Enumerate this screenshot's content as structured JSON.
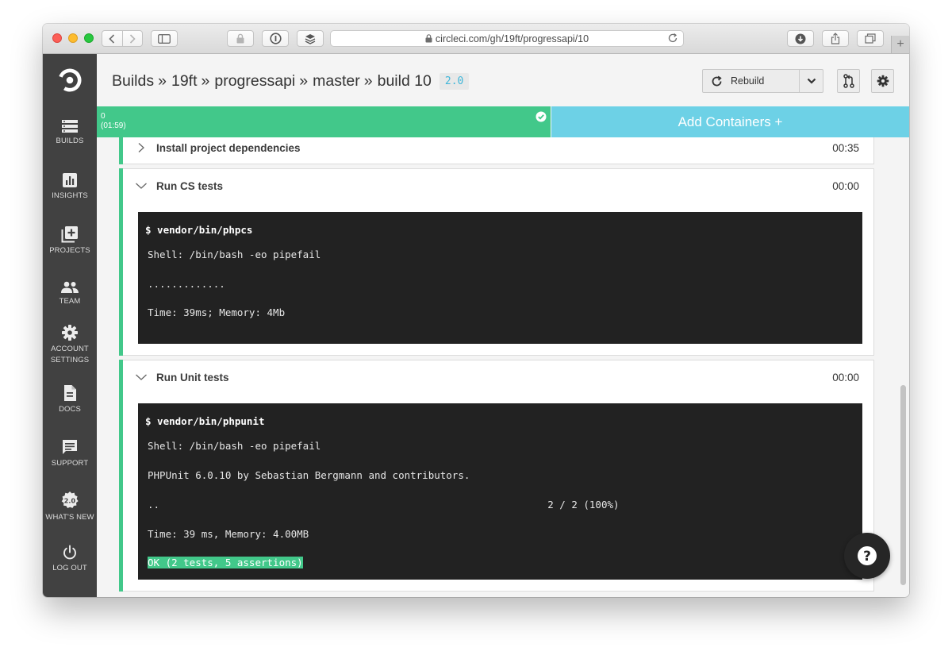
{
  "browser": {
    "url": "circleci.com/gh/19ft/progressapi/10"
  },
  "sidebar": {
    "items": [
      {
        "label": "BUILDS",
        "icon": "builds-icon"
      },
      {
        "label": "INSIGHTS",
        "icon": "insights-icon"
      },
      {
        "label": "PROJECTS",
        "icon": "projects-icon"
      },
      {
        "label": "TEAM",
        "icon": "team-icon"
      },
      {
        "label": "ACCOUNT",
        "label2": "SETTINGS",
        "icon": "gear-icon"
      },
      {
        "label": "DOCS",
        "icon": "docs-icon"
      },
      {
        "label": "SUPPORT",
        "icon": "chat-icon"
      },
      {
        "label": "WHAT'S NEW",
        "icon": "badge-2-0-icon"
      },
      {
        "label": "LOG OUT",
        "icon": "power-icon"
      }
    ]
  },
  "header": {
    "breadcrumb": [
      "Builds",
      "19ft",
      "progressapi",
      "master",
      "build 10"
    ],
    "separator": "»",
    "version_badge": "2.0",
    "rebuild_label": "Rebuild"
  },
  "status": {
    "container_index": "0",
    "container_time": "(01:59)",
    "add_containers": "Add Containers +"
  },
  "steps": [
    {
      "title": "Install project dependencies",
      "duration": "00:35",
      "expanded": false
    },
    {
      "title": "Run CS tests",
      "duration": "00:00",
      "expanded": true,
      "command": "$ vendor/bin/phpcs",
      "output": [
        "Shell: /bin/bash -eo pipefail",
        ".............",
        "Time: 39ms; Memory: 4Mb"
      ]
    },
    {
      "title": "Run Unit tests",
      "duration": "00:00",
      "expanded": true,
      "command": "$ vendor/bin/phpunit",
      "output": [
        "Shell: /bin/bash -eo pipefail",
        "PHPUnit 6.0.10 by Sebastian Bergmann and contributors.",
        "..                                                                 2 / 2 (100%)",
        "Time: 39 ms, Memory: 4.00MB",
        "OK (2 tests, 5 assertions)"
      ]
    }
  ],
  "colors": {
    "success": "#42c88a",
    "add_containers": "#6dd1e6",
    "sidebar": "#414141",
    "terminal": "#222222"
  }
}
